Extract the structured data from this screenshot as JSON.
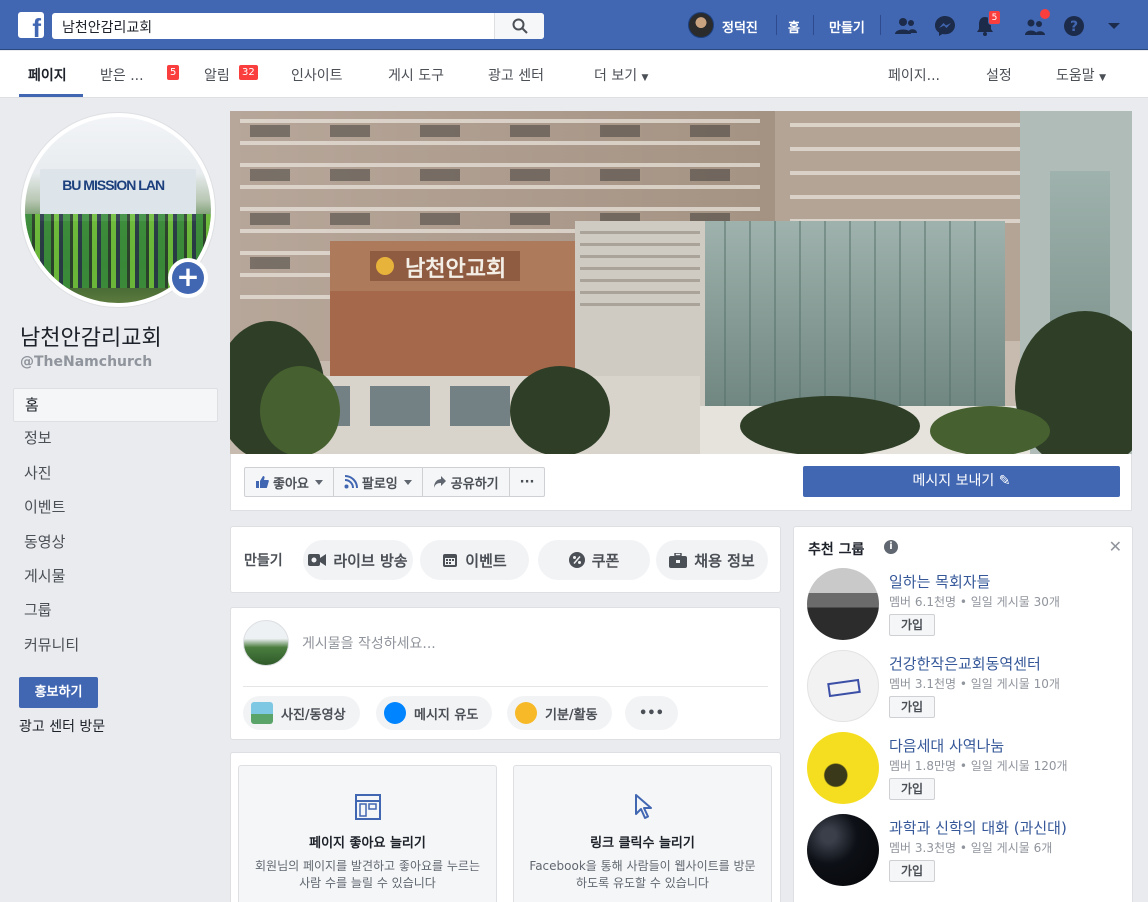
{
  "topbar": {
    "search_value": "남천안감리교회",
    "user_name": "정덕진",
    "home_label": "홈",
    "create_label": "만들기",
    "notifications_count": "5"
  },
  "pagenav": {
    "tabs": [
      {
        "label": "페이지"
      },
      {
        "label": "받은 ...",
        "badge": "5"
      },
      {
        "label": "알림",
        "badge": "32"
      },
      {
        "label": "인사이트"
      },
      {
        "label": "게시 도구"
      },
      {
        "label": "광고 센터"
      },
      {
        "label": "더 보기"
      }
    ],
    "right": [
      "페이지...",
      "설정",
      "도움말"
    ]
  },
  "page": {
    "name": "남천안감리교회",
    "handle": "@TheNamchurch",
    "side_menu": [
      "홈",
      "정보",
      "사진",
      "이벤트",
      "동영상",
      "게시물",
      "그룹",
      "커뮤니티"
    ],
    "promote_label": "홍보하기",
    "ads_center_label": "광고 센터 방문",
    "profile_wall_text": "BU MISSION LAN",
    "cover_sign_text": "남천안교회"
  },
  "actions": {
    "like": "좋아요",
    "follow": "팔로잉",
    "share": "공유하기",
    "more": "···",
    "message": "메시지 보내기"
  },
  "create": {
    "label": "만들기",
    "items": [
      "라이브 방송",
      "이벤트",
      "쿠폰",
      "채용 정보"
    ]
  },
  "composer": {
    "placeholder": "게시물을 작성하세요...",
    "buttons": [
      "사진/동영상",
      "메시지 유도",
      "기분/활동"
    ],
    "more": "•••"
  },
  "promos": [
    {
      "title": "페이지 좋아요 늘리기",
      "desc": "회원님의 페이지를 발견하고 좋아요를 누르는 사람 수를 늘릴 수 있습니다"
    },
    {
      "title": "링크 클릭수 늘리기",
      "desc": "Facebook을 통해 사람들이 웹사이트를 방문하도록 유도할 수 있습니다"
    }
  ],
  "suggested_groups": {
    "title": "추천 그룹",
    "join_label": "가입",
    "items": [
      {
        "name": "일하는 목회자들",
        "meta": "멤버 6.1천명 • 일일 게시물 30개"
      },
      {
        "name": "건강한작은교회동역센터",
        "meta": "멤버 3.1천명 • 일일 게시물 10개"
      },
      {
        "name": "다음세대 사역나눔",
        "meta": "멤버 1.8만명 • 일일 게시물 120개"
      },
      {
        "name": "과학과 신학의 대화 (과신대)",
        "meta": "멤버 3.3천명 • 일일 게시물 6개"
      }
    ]
  },
  "colors": {
    "brand": "#4267b2",
    "badge": "#fa3e3e",
    "background": "#e9ebee"
  }
}
